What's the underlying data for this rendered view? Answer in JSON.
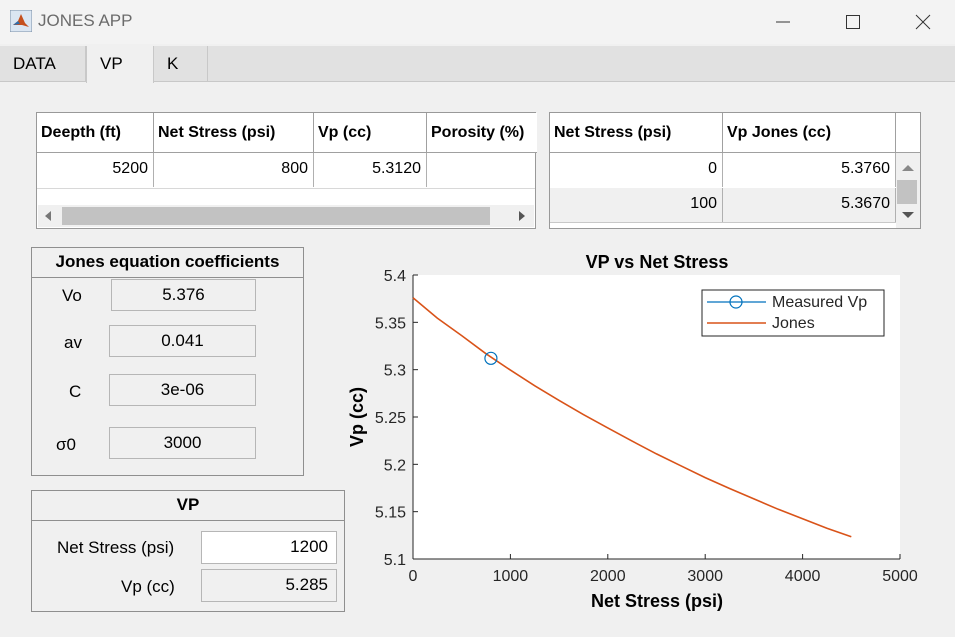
{
  "window": {
    "title": "JONES APP"
  },
  "tabs": [
    {
      "label": "DATA",
      "active": false
    },
    {
      "label": "VP",
      "active": true
    },
    {
      "label": "K",
      "active": false
    }
  ],
  "data_table": {
    "columns": [
      "Deepth (ft)",
      "Net Stress (psi)",
      "Vp (cc)",
      "Porosity (%)"
    ],
    "rows": [
      [
        "5200",
        "800",
        "5.3120",
        ""
      ]
    ]
  },
  "jones_table": {
    "columns": [
      "Net Stress (psi)",
      "Vp Jones (cc)"
    ],
    "rows": [
      [
        "0",
        "5.3760"
      ],
      [
        "100",
        "5.3670"
      ]
    ]
  },
  "coefficients": {
    "title": "Jones equation coefficients",
    "items": [
      {
        "label": "Vo",
        "value": "5.376"
      },
      {
        "label": "av",
        "value": "0.041"
      },
      {
        "label": "C",
        "value": "3e-06"
      },
      {
        "label": "σ0",
        "value": "3000"
      }
    ]
  },
  "vp_panel": {
    "title": "VP",
    "net_stress_label": "Net Stress (psi)",
    "net_stress_value": "1200",
    "vp_label": "Vp (cc)",
    "vp_value": "5.285"
  },
  "colors": {
    "measured": "#0072bd",
    "jones": "#d95319"
  },
  "chart_data": {
    "type": "line",
    "title": "VP vs Net Stress",
    "xlabel": "Net Stress (psi)",
    "ylabel": "Vp (cc)",
    "xlim": [
      0,
      5000
    ],
    "ylim": [
      5.1,
      5.4
    ],
    "xticks": [
      "0",
      "1000",
      "2000",
      "3000",
      "4000",
      "5000"
    ],
    "yticks": [
      "5.1",
      "5.15",
      "5.2",
      "5.25",
      "5.3",
      "5.35",
      "5.4"
    ],
    "legend_position": "top-right",
    "grid": false,
    "series": [
      {
        "name": "Measured Vp",
        "marker": "circle",
        "x": [
          800
        ],
        "y": [
          5.312
        ]
      },
      {
        "name": "Jones",
        "marker": "none",
        "x": [
          0,
          250,
          500,
          750,
          1000,
          1250,
          1500,
          1750,
          2000,
          2250,
          2500,
          2750,
          3000,
          3250,
          3500,
          3750,
          4000,
          4250,
          4500
        ],
        "y": [
          5.376,
          5.3545,
          5.336,
          5.3168,
          5.2995,
          5.283,
          5.2675,
          5.2525,
          5.2385,
          5.2245,
          5.211,
          5.1985,
          5.186,
          5.1745,
          5.1635,
          5.1525,
          5.1425,
          5.1325,
          5.1235
        ]
      }
    ]
  }
}
